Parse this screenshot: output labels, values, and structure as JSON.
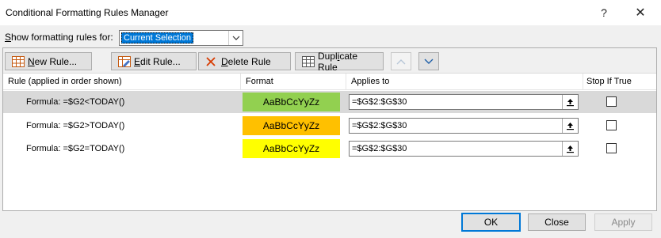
{
  "window": {
    "title": "Conditional Formatting Rules Manager",
    "help": "?",
    "close": "✕"
  },
  "show_rules": {
    "label_prefix": "S",
    "label_rest": "how formatting rules for:",
    "selected": "Current Selection"
  },
  "toolbar": {
    "new_rule_u": "N",
    "new_rule_rest": "ew Rule...",
    "edit_rule_u": "E",
    "edit_rule_rest": "dit Rule...",
    "delete_rule_u": "D",
    "delete_rule_rest": "elete Rule",
    "duplicate_rule_pre": "Dupl",
    "duplicate_rule_u": "i",
    "duplicate_rule_rest": "cate Rule"
  },
  "columns": {
    "rule": "Rule (applied in order shown)",
    "format": "Format",
    "applies_to": "Applies to",
    "stop_if_true": "Stop If True"
  },
  "rules": [
    {
      "rule": "Formula: =$G2<TODAY()",
      "preview": "AaBbCcYyZz",
      "color": "#92d050",
      "applies_to": "=$G$2:$G$30"
    },
    {
      "rule": "Formula: =$G2>TODAY()",
      "preview": "AaBbCcYyZz",
      "color": "#ffc000",
      "applies_to": "=$G$2:$G$30"
    },
    {
      "rule": "Formula: =$G2=TODAY()",
      "preview": "AaBbCcYyZz",
      "color": "#ffff00",
      "applies_to": "=$G$2:$G$30"
    }
  ],
  "buttons": {
    "ok": "OK",
    "close": "Close",
    "apply": "Apply"
  }
}
